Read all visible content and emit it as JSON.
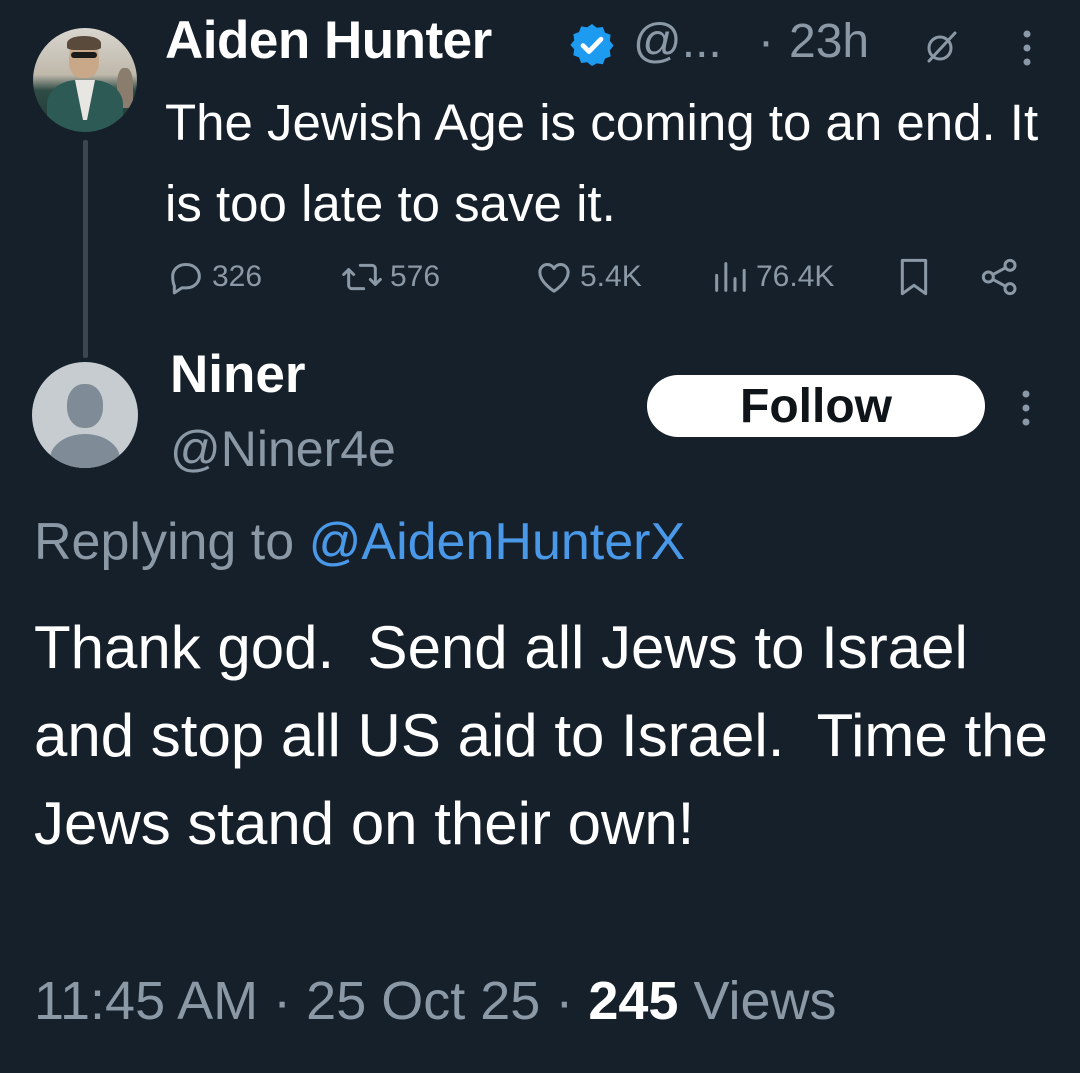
{
  "parent_tweet": {
    "author_name": "Aiden Hunter",
    "handle_truncated": "@...",
    "separator": "·",
    "time_ago": "23h",
    "text": "The Jewish Age is coming to an end. It is too late to save it.",
    "stats": {
      "replies": "326",
      "retweets": "576",
      "likes": "5.4K",
      "views": "76.4K"
    },
    "icons": [
      "verified-badge-icon",
      "grok-icon",
      "more-icon",
      "reply-icon",
      "retweet-icon",
      "like-icon",
      "views-icon",
      "bookmark-icon",
      "share-icon"
    ]
  },
  "reply_tweet": {
    "author_name": "Niner",
    "handle": "@Niner4e",
    "follow_label": "Follow",
    "replying_label": "Replying to",
    "replying_handle": "@AidenHunterX",
    "text": "Thank god.  Send all Jews to Israel and stop all US aid to Israel.  Time the Jews stand on their own!",
    "time": "11:45 AM",
    "sep": "·",
    "date": "25 Oct 25",
    "views_count": "245",
    "views_label": "Views"
  },
  "colors": {
    "background": "#16202b",
    "primary_text": "#ffffff",
    "secondary_text": "#8b98a5",
    "link": "#4a99e9",
    "verified": "#1d9bf0"
  }
}
